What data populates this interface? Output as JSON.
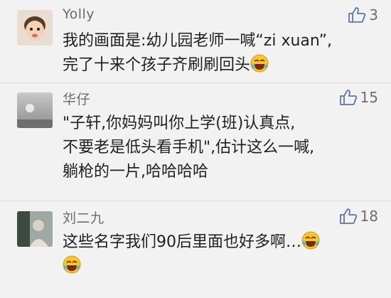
{
  "comments": [
    {
      "username": "Yolly",
      "likes": "3",
      "lines": [
        "我的画面是:幼儿园老师一喊“zi xuan”,",
        "完了十来个孩子齐刷刷回头"
      ],
      "emoji": "laughing-crying-emoji"
    },
    {
      "username": "华仔",
      "likes": "15",
      "lines": [
        "\"子轩,你妈妈叫你上学(班)认真点,",
        "不要老是低头看手机\",估计这么一喊,",
        "躺枪的一片,哈哈哈哈"
      ]
    },
    {
      "username": "刘二九",
      "likes": "18",
      "lines": [
        "这些名字我们90后里面也好多啊…"
      ],
      "emoji": "laughing-crying-emoji"
    }
  ],
  "colors": {
    "background": "#f2f2f2",
    "username": "#6b6b6b",
    "text": "#1f1f1f",
    "divider": "#dcdcdc"
  }
}
